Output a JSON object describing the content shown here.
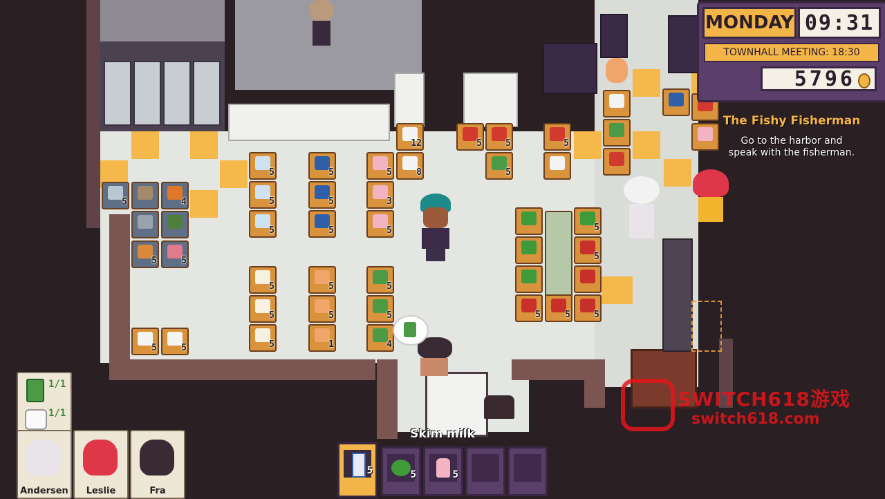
{
  "hud": {
    "day": "MONDAY",
    "time": "09:31",
    "event": "TOWNHALL MEETING: 18:30",
    "money": "5796"
  },
  "quest": {
    "title": "The Fishy Fisherman",
    "description": "Go to the harbor and speak with the fisherman."
  },
  "shopping_list": [
    {
      "item_icon": "canned-food-icon",
      "progress": "1/1"
    },
    {
      "item_icon": "toilet-paper-icon",
      "progress": "1/1"
    }
  ],
  "party": [
    {
      "name": "Andersen"
    },
    {
      "name": "Leslie"
    },
    {
      "name": "Fra"
    }
  ],
  "inventory": {
    "selected_label": "Skim milk",
    "slots": [
      {
        "icon": "milk-carton-icon",
        "count": "5",
        "selected": true
      },
      {
        "icon": "lettuce-icon",
        "count": "5"
      },
      {
        "icon": "milk-bottle-icon",
        "count": "5"
      },
      {
        "icon": "empty-slot",
        "count": ""
      },
      {
        "icon": "empty-slot",
        "count": ""
      }
    ]
  },
  "shelves": [
    {
      "item": "meat",
      "count": "5"
    },
    {
      "item": "meat",
      "count": "4"
    },
    {
      "item": "meat",
      "count": "5"
    },
    {
      "item": "meat",
      "count": "5"
    },
    {
      "item": "bowl",
      "count": "5"
    },
    {
      "item": "bowl",
      "count": "5"
    },
    {
      "item": "bowl",
      "count": "5"
    },
    {
      "item": "box",
      "count": "5"
    },
    {
      "item": "box",
      "count": "5"
    },
    {
      "item": "box",
      "count": "5"
    },
    {
      "item": "bottle",
      "count": "5"
    },
    {
      "item": "bottle",
      "count": "3"
    },
    {
      "item": "bottle",
      "count": "5"
    },
    {
      "item": "paper",
      "count": "12"
    },
    {
      "item": "paper",
      "count": "8"
    },
    {
      "item": "oat",
      "count": "5"
    },
    {
      "item": "oat",
      "count": "5"
    },
    {
      "item": "oat",
      "count": "5"
    },
    {
      "item": "bread",
      "count": "5"
    },
    {
      "item": "bread",
      "count": "5"
    },
    {
      "item": "bread",
      "count": "1"
    },
    {
      "item": "can",
      "count": "5"
    },
    {
      "item": "can",
      "count": "5"
    },
    {
      "item": "can",
      "count": "4"
    },
    {
      "item": "paper",
      "count": "5"
    },
    {
      "item": "paper",
      "count": "5"
    },
    {
      "item": "lettuce",
      "count": "5"
    },
    {
      "item": "lettuce",
      "count": "5"
    },
    {
      "item": "apple",
      "count": "5"
    },
    {
      "item": "apple",
      "count": "5"
    },
    {
      "item": "apple",
      "count": "5"
    },
    {
      "item": "red",
      "count": "5"
    },
    {
      "item": "red",
      "count": "5"
    },
    {
      "item": "red",
      "count": "5"
    },
    {
      "item": "can",
      "count": "5"
    }
  ],
  "watermark": {
    "line1": "SWITCH618游戏",
    "line2": "switch618.com"
  },
  "colors": {
    "accent": "#f4b548",
    "panel": "#5b3f6a",
    "wall": "#7a5551",
    "floor": "#e3e6e1"
  }
}
